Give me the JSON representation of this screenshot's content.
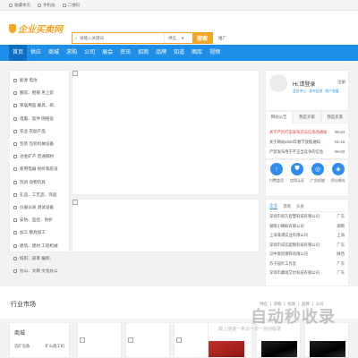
{
  "topbar": {
    "links": [
      "收藏本页",
      "手机站",
      "二维码"
    ]
  },
  "header": {
    "logo_text": "企业买卖网",
    "search_placeholder": "请输入关键词",
    "search_type": "供应",
    "search_button": "搜索",
    "ad_label": "推广"
  },
  "nav": {
    "items": [
      "首页",
      "供应",
      "商城",
      "求购",
      "公司",
      "展会",
      "资讯",
      "招商",
      "品牌",
      "知道",
      "图库",
      "视频"
    ]
  },
  "sidebar": {
    "items": [
      "能源 电池",
      "服装、鞋帽 男上装",
      "家居用品 餐具、碗、",
      "电脑、软件 网络设",
      "农业 农副产品",
      "包装 包装机械设备",
      "冶金矿产 普通钢材",
      "家用电器 视听家庭设",
      "玩具 动物玩具",
      "礼品、工艺品、饰品",
      "仪器仪表 测试设备",
      "安防、监控、防护",
      "加工 模具加工",
      "建筑、建材 工程机械",
      "纺织、皮革 编织、",
      "办公、文教 文化办公"
    ]
  },
  "user": {
    "greeting": "Hi,请登录",
    "register": "注册",
    "links": [
      "会员中心",
      "发布信息",
      "账户充值"
    ],
    "tabs": [
      "网站公告",
      "我是买家",
      "我是卖家"
    ]
  },
  "news": [
    {
      "title": "关于严厉打击发布违法信息的通知",
      "date": "06-24"
    },
    {
      "title": "关于网站2020年春节放假通知",
      "date": "01-16"
    },
    {
      "title": "严禁发布用于不正当竞争的信息",
      "date": "06-03"
    }
  ],
  "tools": [
    {
      "icon": "↑",
      "label": "付费会员"
    },
    {
      "icon": "⛊",
      "label": "信用认证"
    },
    {
      "icon": "◎",
      "label": "广告投放"
    },
    {
      "icon": "◈",
      "label": "积分换礼"
    }
  ],
  "companies": {
    "tabs": [
      "企业",
      "求购",
      "头条"
    ],
    "rows": [
      {
        "name": "深圳市权久智慧科技有限公司",
        "region": "广东"
      },
      {
        "name": "湖南小蝌蚪有限公司",
        "region": "湖南"
      },
      {
        "name": "上海渝溥实业有限公司",
        "region": "上海"
      },
      {
        "name": "深圳市成实超制科技有限公司",
        "region": "广东"
      },
      {
        "name": "汉中商贸钢铁有限公司",
        "region": "陕西"
      },
      {
        "name": "苏子园针工作室",
        "region": "广东"
      },
      {
        "name": "深圳市康瑞艾尔科技有限公司",
        "region": "广东"
      }
    ]
  },
  "market": {
    "title": "行业市场",
    "tabs": [
      "供应",
      "求购",
      "招商",
      "品牌",
      "公司"
    ]
  },
  "category": {
    "heading": "商城",
    "sub": [
      "选矿设备",
      "矿山施工机"
    ]
  },
  "watermark": {
    "main": "自动秒收录",
    "sub": "做上链接一来访一次一自动收录"
  },
  "colors": {
    "nav_blue": "#1e8fe8",
    "accent_orange": "#f5a623",
    "hot_red": "#e4393c"
  }
}
